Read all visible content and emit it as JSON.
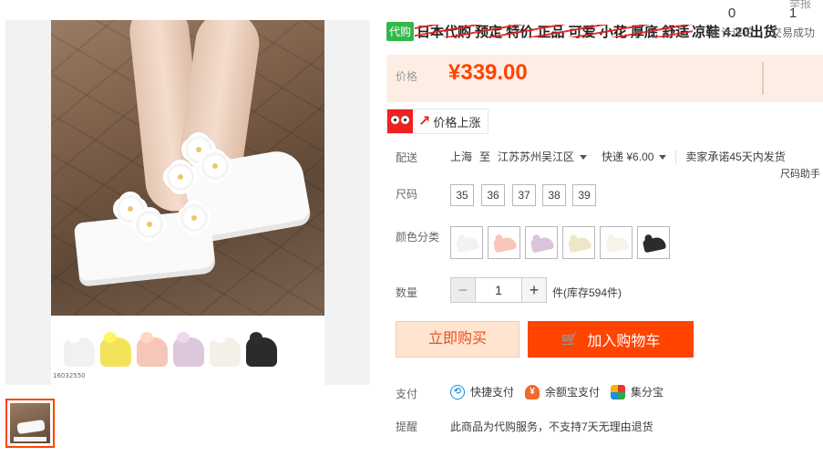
{
  "header": {
    "report_link": "举报"
  },
  "title": {
    "badge": "代购",
    "struck_text": "日本代购 预定 特价 正品 可爱 小花 厚底 舒适",
    "tail_text": "凉鞋 4.20出货"
  },
  "gallery": {
    "product_code": "16032550"
  },
  "price": {
    "label": "价格",
    "value": "¥339.00",
    "reviews_count": "0",
    "reviews_label": "累计评论",
    "deals_count": "1",
    "deals_label": "交易成功",
    "accent_color": "#ff4400",
    "box_color": "#fdeee5"
  },
  "price_alert": {
    "label": "价格上涨",
    "icon": "owl-icon"
  },
  "shipping": {
    "label": "配送",
    "from": "上海",
    "to_word": "至",
    "destination": "江苏苏州吴江区",
    "method": "快递 ¥6.00",
    "promise": "卖家承诺45天内发货"
  },
  "size": {
    "label": "尺码",
    "helper": "尺码助手",
    "options": [
      "35",
      "36",
      "37",
      "38",
      "39"
    ]
  },
  "color": {
    "label": "颜色分类",
    "options": [
      {
        "name": "white",
        "swatch": "#f2f2f2"
      },
      {
        "name": "pink",
        "swatch": "#f6c7b8"
      },
      {
        "name": "lavender",
        "swatch": "#d9c4dc"
      },
      {
        "name": "cream",
        "swatch": "#efe6c9"
      },
      {
        "name": "white-gold",
        "swatch": "#f7f3ea"
      },
      {
        "name": "black",
        "swatch": "#2b2b2b"
      }
    ]
  },
  "quantity": {
    "label": "数量",
    "minus": "−",
    "value": "1",
    "plus": "+",
    "stock": "件(库存594件)"
  },
  "actions": {
    "buy_now": "立即购买",
    "add_to_cart": "加入购物车"
  },
  "payment": {
    "label": "支付",
    "methods": [
      {
        "label": "快捷支付",
        "icon": "quick-pay-icon"
      },
      {
        "label": "余额宝支付",
        "icon": "yuebao-icon"
      },
      {
        "label": "集分宝",
        "icon": "jifenbao-icon"
      }
    ]
  },
  "notice": {
    "label": "提醒",
    "text": "此商品为代购服务，不支持7天无理由退货"
  }
}
